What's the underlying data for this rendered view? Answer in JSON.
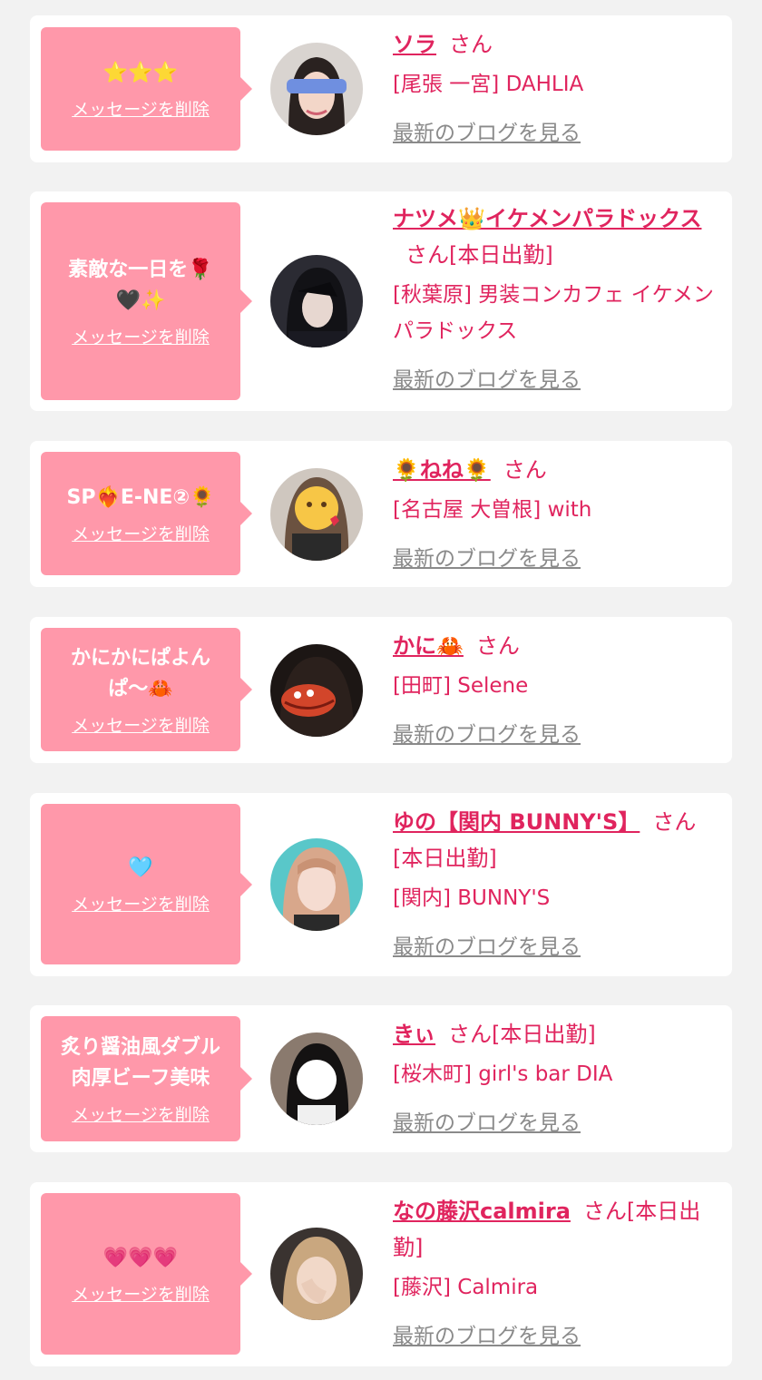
{
  "colors": {
    "accent": "#e0245e",
    "bubble": "#ff98aa",
    "background": "#f2f2f2"
  },
  "favorites": [
    {
      "message": "⭐⭐⭐",
      "delete_label": "メッセージを削除",
      "name": "ソラ",
      "san": "さん",
      "status": "",
      "shop": "[尾張 一宮] DAHLIA",
      "blog": "最新のブログを見る",
      "avatar": "avatar-sora"
    },
    {
      "message": "素敵な一日を🌹🖤✨",
      "delete_label": "メッセージを削除",
      "name": "ナツメ👑イケメンパラドックス",
      "san": "さん",
      "status": "[本日出勤]",
      "shop": "[秋葉原] 男装コンカフェ イケメンパラドックス",
      "blog": "最新のブログを見る",
      "avatar": "avatar-natsume"
    },
    {
      "message": "SP❤️‍🔥E-NE②🌻",
      "delete_label": "メッセージを削除",
      "name": "🌻ねね🌻",
      "san": "さん",
      "status": "",
      "shop": "[名古屋 大曽根] with",
      "blog": "最新のブログを見る",
      "avatar": "avatar-nene"
    },
    {
      "message": "かにかにぱよんぱ〜🦀",
      "delete_label": "メッセージを削除",
      "name": "かに🦀",
      "san": "さん",
      "status": "",
      "shop": "[田町] Selene",
      "blog": "最新のブログを見る",
      "avatar": "avatar-kani"
    },
    {
      "message": "🩵",
      "delete_label": "メッセージを削除",
      "name": "ゆの【関内 BUNNY'S】",
      "san": "さん",
      "status": "[本日出勤]",
      "shop": "[関内] BUNNY'S",
      "blog": "最新のブログを見る",
      "avatar": "avatar-yuno"
    },
    {
      "message": "炙り醤油風ダブル肉厚ビーフ美味",
      "delete_label": "メッセージを削除",
      "name": "きぃ",
      "san": "さん",
      "status": "[本日出勤]",
      "shop": "[桜木町] girl's bar DIA",
      "blog": "最新のブログを見る",
      "avatar": "avatar-kii"
    },
    {
      "message": "💗💗💗",
      "delete_label": "メッセージを削除",
      "name": "なの藤沢calmira",
      "san": "さん",
      "status": "[本日出勤]",
      "shop": "[藤沢] Calmira",
      "blog": "最新のブログを見る",
      "avatar": "avatar-nano"
    }
  ]
}
